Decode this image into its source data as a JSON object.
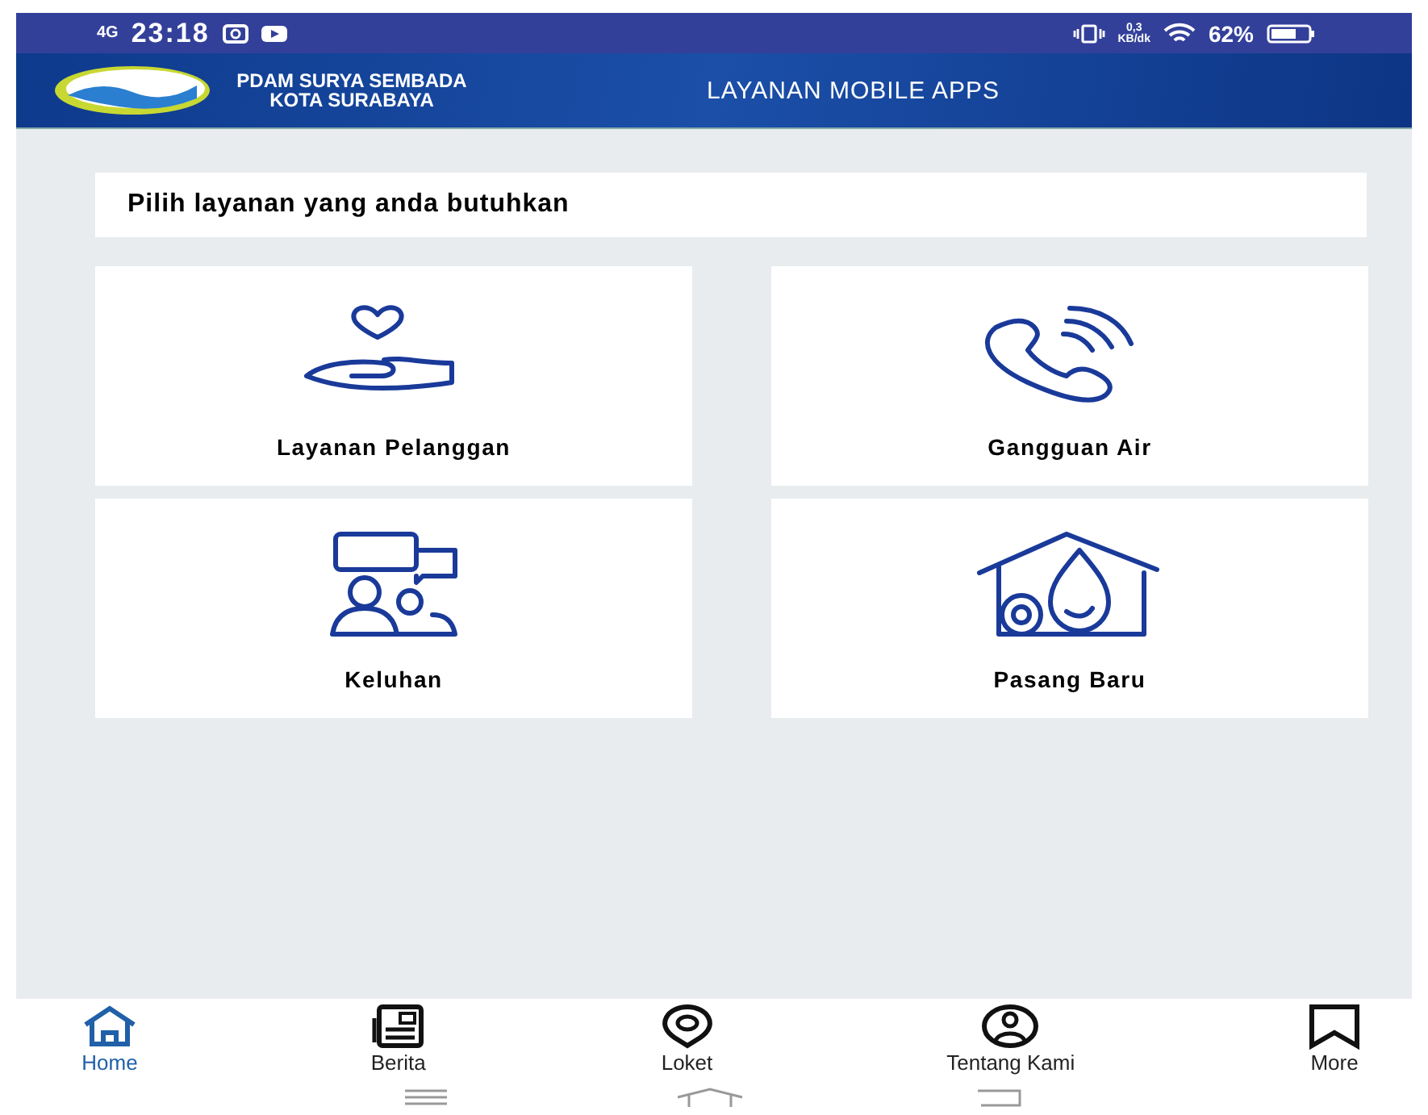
{
  "status_bar": {
    "network": "4G",
    "time": "23:18",
    "speed": "0,3",
    "speed_unit": "KB/dk",
    "battery": "62%"
  },
  "header": {
    "org_line1": "PDAM SURYA SEMBADA",
    "org_line2": "KOTA SURABAYA",
    "title": "LAYANAN MOBILE APPS"
  },
  "prompt": "Pilih layanan yang anda butuhkan",
  "services": [
    {
      "kind": "care",
      "label": "Layanan Pelanggan"
    },
    {
      "kind": "phone",
      "label": "Gangguan Air"
    },
    {
      "kind": "chat",
      "label": "Keluhan"
    },
    {
      "kind": "house",
      "label": "Pasang Baru"
    }
  ],
  "nav": [
    {
      "kind": "home",
      "label": "Home",
      "selected": true
    },
    {
      "kind": "news",
      "label": "Berita",
      "selected": false
    },
    {
      "kind": "pin",
      "label": "Loket",
      "selected": false
    },
    {
      "kind": "person",
      "label": "Tentang Kami",
      "selected": false
    },
    {
      "kind": "more",
      "label": "More",
      "selected": false
    }
  ]
}
